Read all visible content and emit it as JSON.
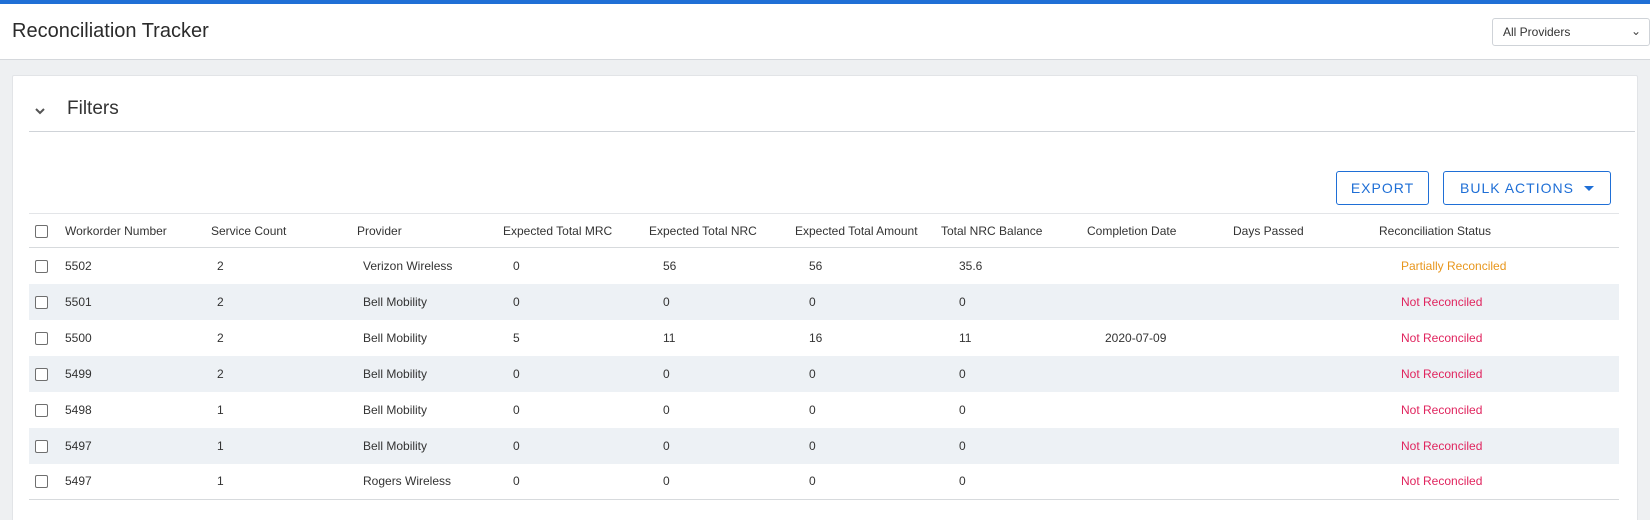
{
  "header": {
    "title": "Reconciliation Tracker",
    "provider_select": {
      "value": "All Providers"
    }
  },
  "filters": {
    "label": "Filters"
  },
  "actions": {
    "export_label": "EXPORT",
    "bulk_label": "BULK ACTIONS"
  },
  "colors": {
    "accent": "#1f6fd6",
    "partial": "#e8961c",
    "not_reconciled": "#e0245e"
  },
  "table": {
    "columns": [
      "Workorder Number",
      "Service Count",
      "Provider",
      "Expected Total MRC",
      "Expected Total NRC",
      "Expected Total Amount",
      "Total NRC Balance",
      "Completion Date",
      "Days Passed",
      "Reconciliation Status"
    ],
    "rows": [
      [
        "5502",
        "2",
        "Verizon Wireless",
        "0",
        "56",
        "56",
        "35.6",
        "",
        "",
        "Partially Reconciled"
      ],
      [
        "5501",
        "2",
        "Bell Mobility",
        "0",
        "0",
        "0",
        "0",
        "",
        "",
        "Not Reconciled"
      ],
      [
        "5500",
        "2",
        "Bell Mobility",
        "5",
        "11",
        "16",
        "11",
        "2020-07-09",
        "",
        "Not Reconciled"
      ],
      [
        "5499",
        "2",
        "Bell Mobility",
        "0",
        "0",
        "0",
        "0",
        "",
        "",
        "Not Reconciled"
      ],
      [
        "5498",
        "1",
        "Bell Mobility",
        "0",
        "0",
        "0",
        "0",
        "",
        "",
        "Not Reconciled"
      ],
      [
        "5497",
        "1",
        "Bell Mobility",
        "0",
        "0",
        "0",
        "0",
        "",
        "",
        "Not Reconciled"
      ],
      [
        "5497",
        "1",
        "Rogers Wireless",
        "0",
        "0",
        "0",
        "0",
        "",
        "",
        "Not Reconciled"
      ]
    ]
  }
}
